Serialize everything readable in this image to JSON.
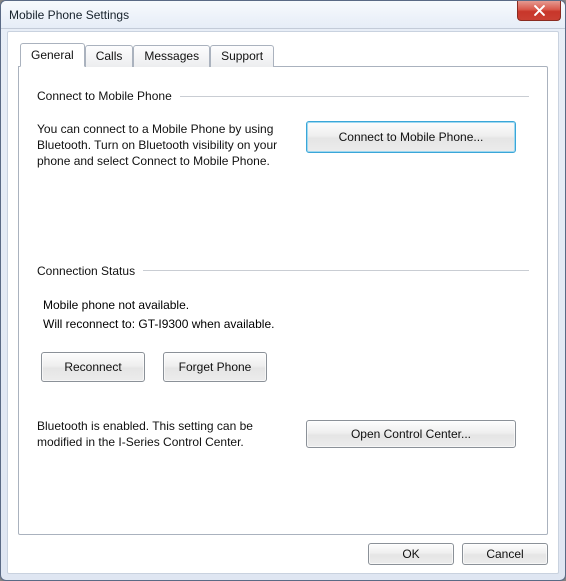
{
  "window": {
    "title": "Mobile Phone Settings"
  },
  "tabs": {
    "general": "General",
    "calls": "Calls",
    "messages": "Messages",
    "support": "Support"
  },
  "section_connect": {
    "heading": "Connect to Mobile Phone",
    "desc": "You can connect to a Mobile Phone by using Bluetooth. Turn on Bluetooth visibility on your phone and select Connect to Mobile Phone.",
    "button": "Connect to Mobile Phone..."
  },
  "section_status": {
    "heading": "Connection Status",
    "line1": "Mobile phone not available.",
    "line2": "Will reconnect to: GT-I9300 when available.",
    "reconnect": "Reconnect",
    "forget": "Forget Phone"
  },
  "section_bluetooth": {
    "desc": "Bluetooth is enabled. This setting can be modified in the I-Series Control Center.",
    "button": "Open Control Center..."
  },
  "footer": {
    "ok": "OK",
    "cancel": "Cancel"
  }
}
